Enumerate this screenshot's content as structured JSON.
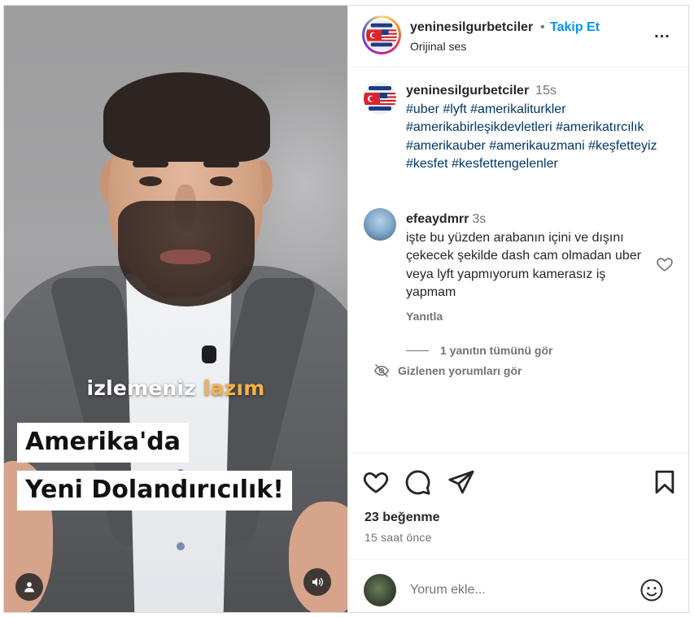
{
  "post": {
    "username": "yeninesilgurbetciler",
    "separator": "•",
    "follow_label": "Takip Et",
    "audio_label": "Orijinal ses",
    "more_label": "..."
  },
  "video": {
    "subtitle_word_1": "izlemeniz",
    "subtitle_word_2": "lazım",
    "title_line_1": "Amerika'da",
    "title_line_2": "Yeni Dolandırıcılık!",
    "colors": {
      "subtitle_white": "#ffffff",
      "subtitle_orange": "#f6b14a"
    }
  },
  "caption": {
    "username": "yeninesilgurbetciler",
    "time": "15s",
    "hashtags": "#uber #lyft #amerikaliturkler #amerikabirleşikdevletleri #amerikatırcılık #amerikauber #amerikauzmani #keşfetteyiz #kesfet #kesfettengelenler"
  },
  "comment": {
    "username": "efeaydmrr",
    "time": "3s",
    "text": "işte bu yüzden arabanın içini ve dışını çekecek şekilde dash cam olmadan uber veya lyft yapmıyorum kamerasız iş yapmam",
    "reply_label": "Yanıtla",
    "view_replies_label": "1 yanıtın tümünü gör"
  },
  "hidden_comments_label": "Gizlenen yorumları gör",
  "engagement": {
    "likes": "23 beğenme",
    "time_ago": "15 saat önce"
  },
  "composer": {
    "placeholder": "Yorum ekle..."
  },
  "icons": {
    "like": "heart-icon",
    "comment": "comment-bubble-icon",
    "share": "paper-plane-icon",
    "save": "bookmark-icon",
    "emoji": "smiley-icon",
    "hidden": "eye-slash-icon",
    "user": "user-icon",
    "sound": "speaker-icon"
  },
  "colors": {
    "link_blue": "#0095f6",
    "hashtag_blue": "#00376b",
    "muted": "#737373",
    "text": "#262626"
  }
}
